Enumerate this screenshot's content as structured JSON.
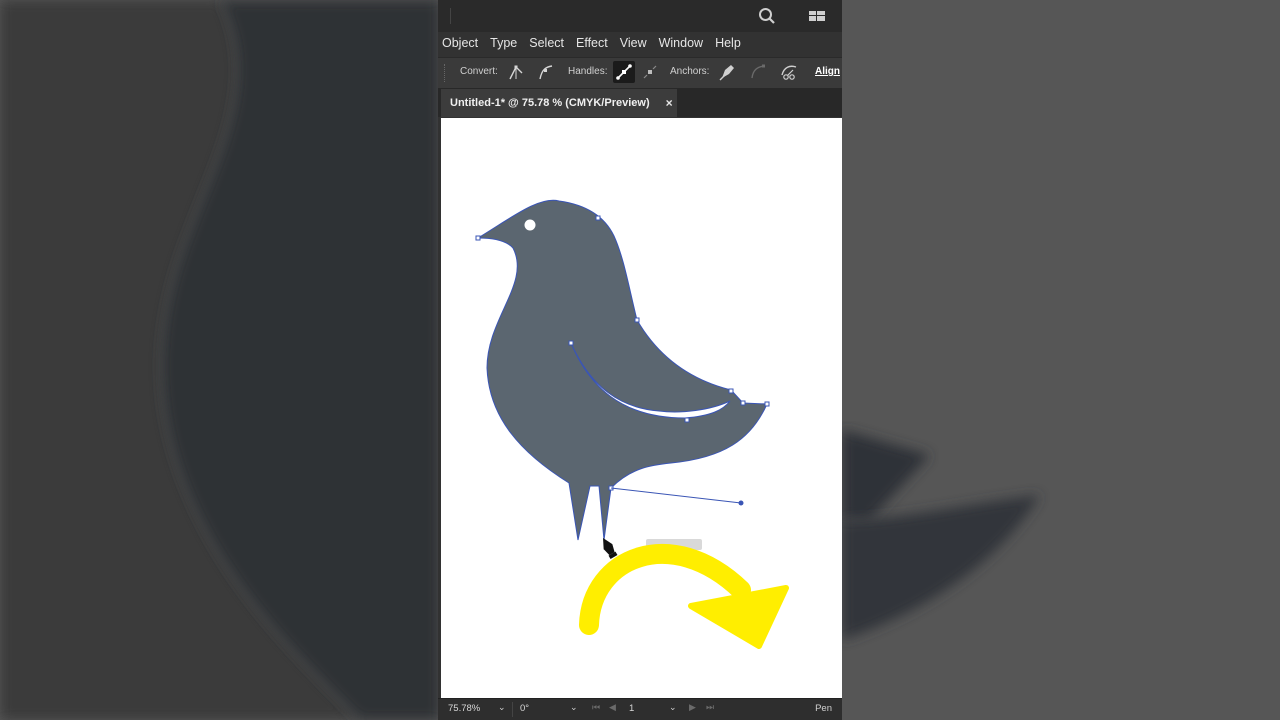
{
  "menu": [
    "Object",
    "Type",
    "Select",
    "Effect",
    "View",
    "Window",
    "Help"
  ],
  "control_bar": {
    "convert_label": "Convert:",
    "handles_label": "Handles:",
    "anchors_label": "Anchors:",
    "align_label": "Align"
  },
  "document_tab": {
    "title": "Untitled-1* @ 75.78 % (CMYK/Preview)",
    "close": "×"
  },
  "status_bar": {
    "zoom": "75.78%",
    "rotation": "0°",
    "artboard": "1",
    "current_tool": "Pen"
  },
  "colors": {
    "bird_fill": "#5b6670",
    "path_stroke": "#3a55b5",
    "arrow": "#ffee00"
  },
  "icons": [
    "search-icon",
    "workspace-icon",
    "convert-corner-icon",
    "convert-smooth-icon",
    "handles-show-icon",
    "handles-hide-icon",
    "remove-anchor-icon",
    "connect-anchor-icon",
    "cut-path-icon",
    "pen-cursor-icon"
  ]
}
